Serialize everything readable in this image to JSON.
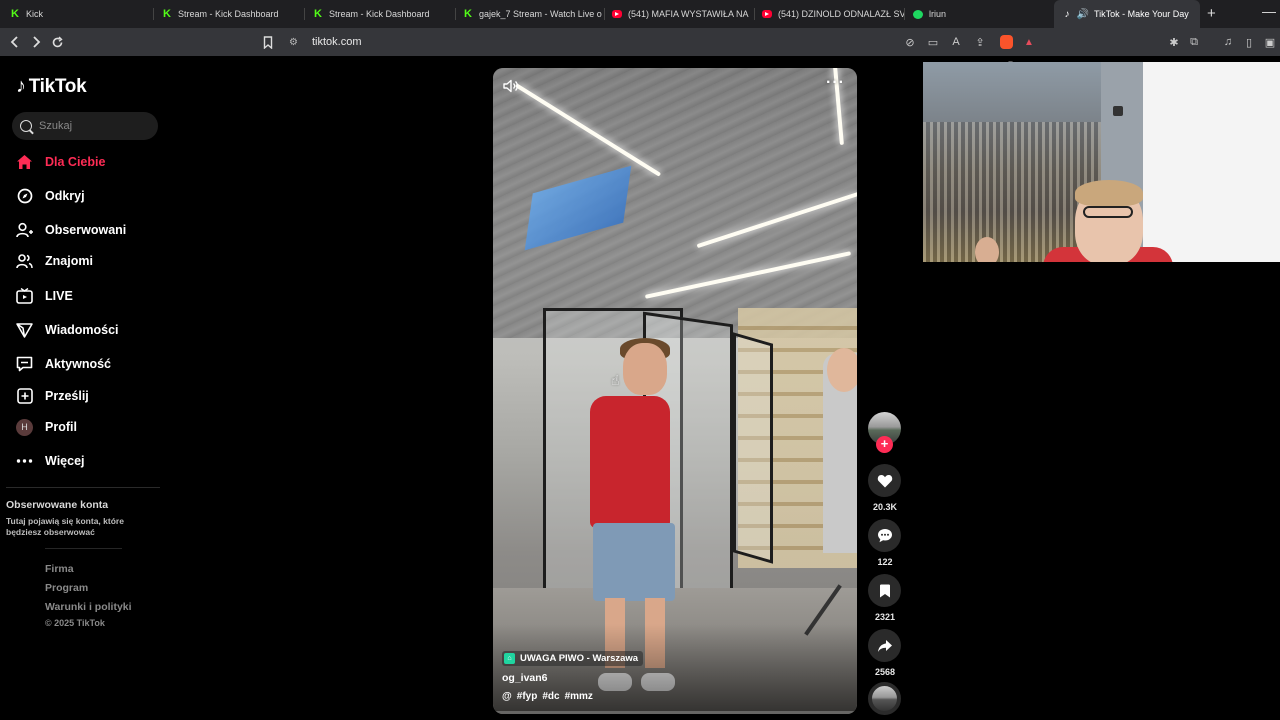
{
  "browser": {
    "tabs": [
      {
        "title": "Kick",
        "icon": "kick-icon"
      },
      {
        "title": "Stream - Kick Dashboard",
        "icon": "kick-icon"
      },
      {
        "title": "Stream - Kick Dashboard",
        "icon": "kick-icon"
      },
      {
        "title": "gajek_7 Stream - Watch Live o",
        "icon": "kick-icon"
      },
      {
        "title": "(541) MAFIA WYSTAWIŁA NA",
        "icon": "youtube-icon"
      },
      {
        "title": "(541) DZINOLD ODNALAZŁ SV",
        "icon": "youtube-icon"
      },
      {
        "title": "lriun",
        "icon": "green-dot-icon"
      },
      {
        "title": "TikTok - Make Your Day",
        "icon": "tiktok-icon",
        "active": true
      }
    ],
    "url": "tiktok.com",
    "brave_badge": "6"
  },
  "tiktok": {
    "logo_text": "TikTok",
    "search_placeholder": "Szukaj",
    "nav": [
      {
        "label": "Dla Ciebie",
        "icon": "home-icon",
        "active": true
      },
      {
        "label": "Odkryj",
        "icon": "compass-icon"
      },
      {
        "label": "Obserwowani",
        "icon": "user-follow-icon"
      },
      {
        "label": "Znajomi",
        "icon": "friends-icon"
      },
      {
        "label": "LIVE",
        "icon": "live-tv-icon"
      },
      {
        "label": "Wiadomości",
        "icon": "send-icon"
      },
      {
        "label": "Aktywność",
        "icon": "activity-icon"
      },
      {
        "label": "Prześlij",
        "icon": "upload-icon"
      },
      {
        "label": "Profil",
        "icon": "avatar",
        "avatar_letter": "H"
      },
      {
        "label": "Więcej",
        "icon": "more-dots-icon"
      }
    ],
    "followed_accounts": {
      "title": "Obserwowane konta",
      "description": "Tutaj pojawią się konta, które będziesz obserwować"
    },
    "footer": {
      "links": [
        "Firma",
        "Program",
        "Warunki i polityki"
      ],
      "copyright": "© 2025 TikTok"
    }
  },
  "video": {
    "location": "UWAGA PIWO - Warszawa",
    "author": "og_ivan6",
    "description_prefix": "@",
    "hashtags": [
      "#fyp",
      "#dc",
      "#mmz"
    ],
    "progress": 0.0,
    "actions": {
      "likes": "20.3K",
      "comments": "122",
      "saves": "2321",
      "shares": "2568"
    }
  },
  "colors": {
    "accent": "#fe2c55",
    "background": "#000000",
    "action_bg": "#2a2a2a"
  }
}
